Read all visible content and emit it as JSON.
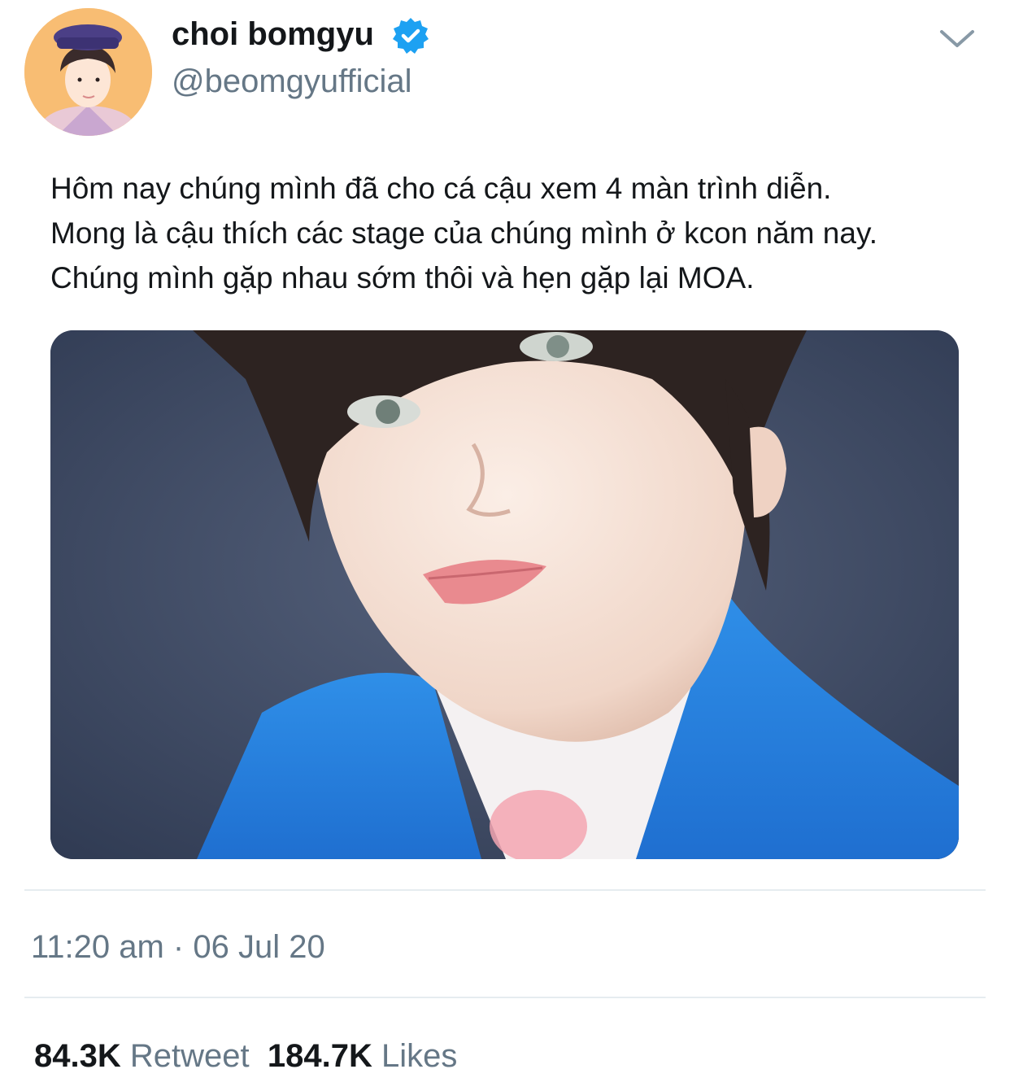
{
  "user": {
    "display_name": "choi bomgyu",
    "handle": "@beomgyufficial",
    "verified_icon": "verified-badge-icon"
  },
  "menu_icon": "chevron-down-icon",
  "tweet": {
    "lines": [
      "Hôm nay chúng mình đã cho cá cậu xem 4 màn trình diễn.",
      "Mong là cậu thích các stage của chúng mình ở kcon năm nay.",
      "Chúng mình gặp nhau sớm thôi và hẹn gặp lại MOA."
    ],
    "timestamp": "11:20 am · 06 Jul 20"
  },
  "stats": {
    "retweets_count": "84.3K",
    "retweets_label": "Retweet",
    "likes_count": "184.7K",
    "likes_label": "Likes"
  },
  "colors": {
    "text": "#14171a",
    "secondary": "#657786",
    "verified": "#1da1f2",
    "divider": "#e6ecf0"
  }
}
